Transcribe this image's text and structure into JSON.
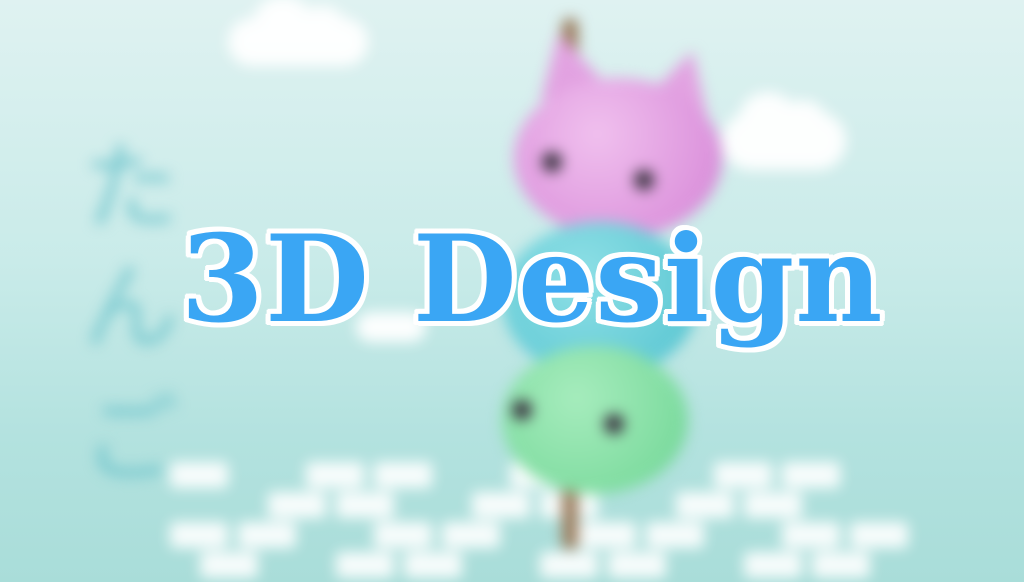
{
  "title": "3D Design",
  "background_text": [
    "た",
    "ん",
    "ご"
  ],
  "colors": {
    "title_fill": "#3aa6f4",
    "title_outline": "#ffffff",
    "background_top": "#dff2f1",
    "background_bottom": "#a9ddd9",
    "dango_pink": "#dd95dd",
    "dango_blue": "#64cbd6",
    "dango_green": "#7fdca0",
    "stick": "#9a7b5c"
  }
}
